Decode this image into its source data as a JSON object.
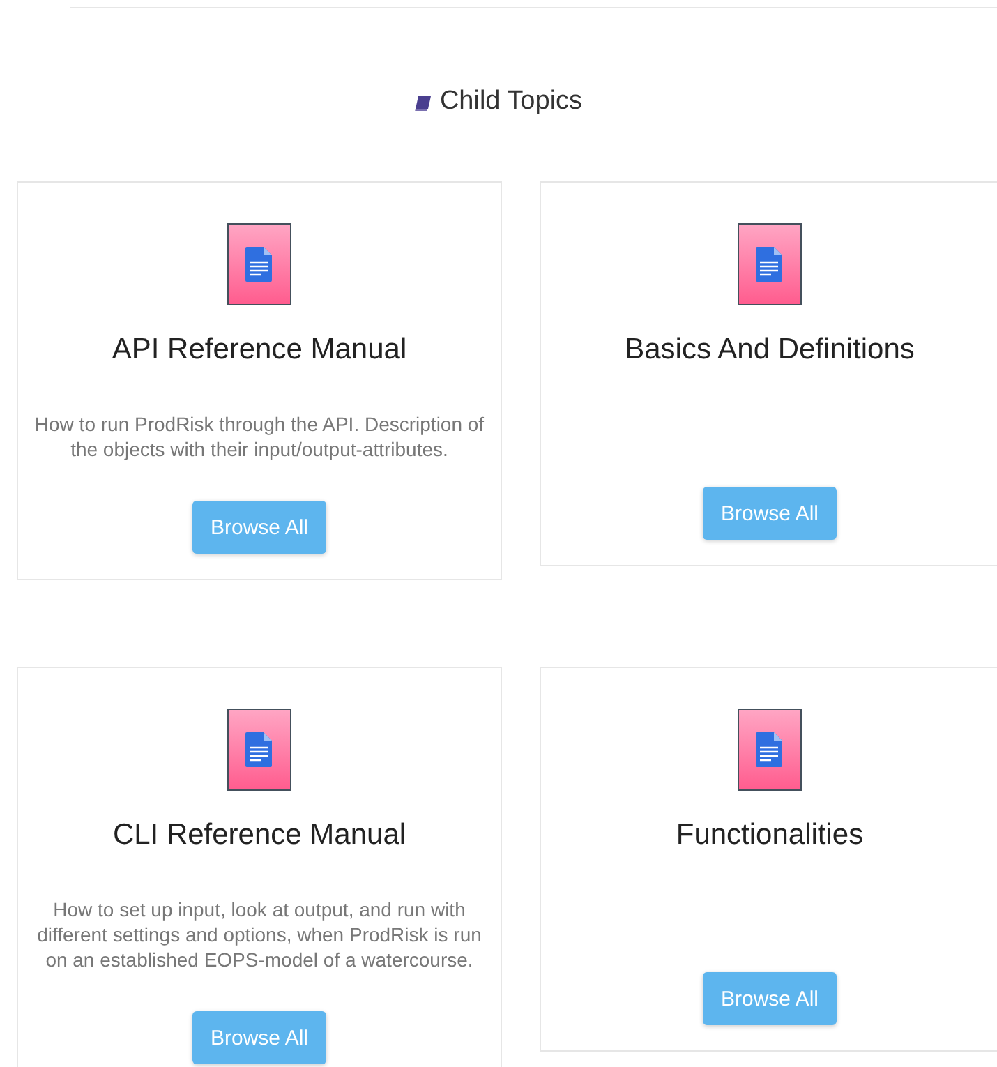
{
  "heading": "Child Topics",
  "topics": [
    {
      "title": "API Reference Manual",
      "description": "How to run ProdRisk through the API. Description of the objects with their input/output-attributes.",
      "button": "Browse All"
    },
    {
      "title": "Basics And Definitions",
      "button": "Browse All"
    },
    {
      "title": "CLI Reference Manual",
      "description": "How to set up input, look at output, and run with different settings and options, when ProdRisk is run on an established EOPS-model of a watercourse.",
      "button": "Browse All"
    },
    {
      "title": "Functionalities",
      "button": "Browse All"
    }
  ]
}
